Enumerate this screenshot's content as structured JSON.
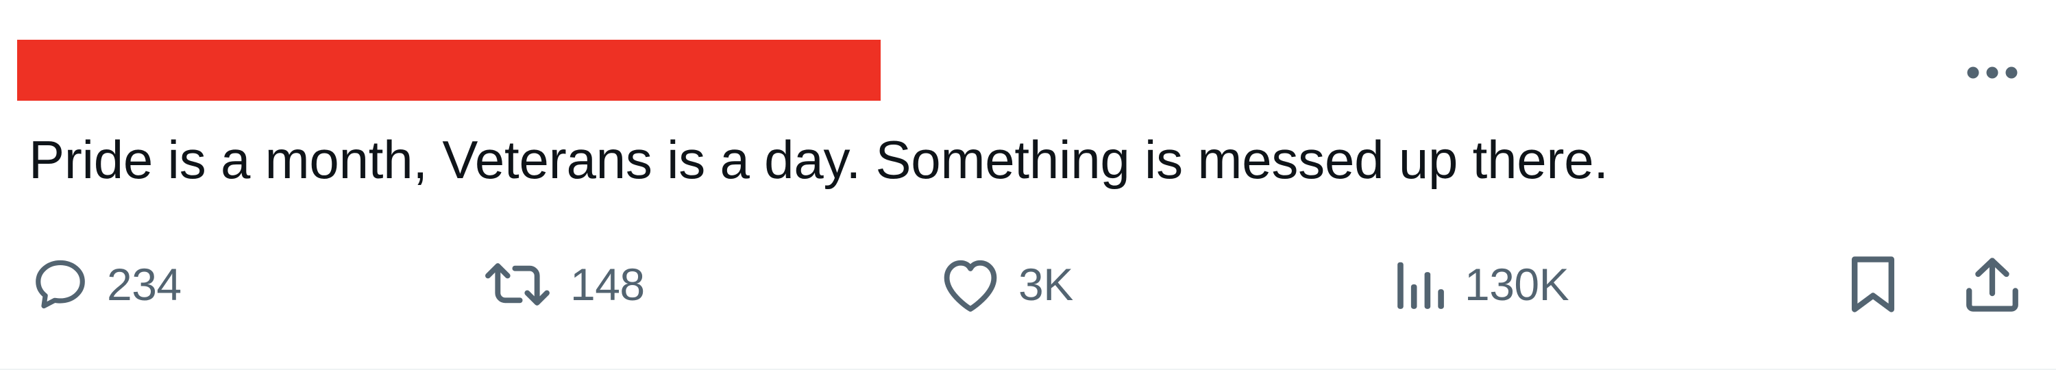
{
  "tweet": {
    "text": "Pride is a month, Veterans is a day. Something is messed up there."
  },
  "actions": {
    "replies": "234",
    "retweets": "148",
    "likes": "3K",
    "views": "130K"
  },
  "icons": {
    "reply": "reply-bubble-icon",
    "retweet": "retweet-icon",
    "like": "heart-icon",
    "views": "analytics-bars-icon",
    "bookmark": "bookmark-icon",
    "share": "share-upload-icon",
    "more": "more-horizontal-icon"
  },
  "colors": {
    "text": "#0f1419",
    "secondary": "#536471",
    "redaction": "#ee3124",
    "divider": "#eff3f4"
  }
}
